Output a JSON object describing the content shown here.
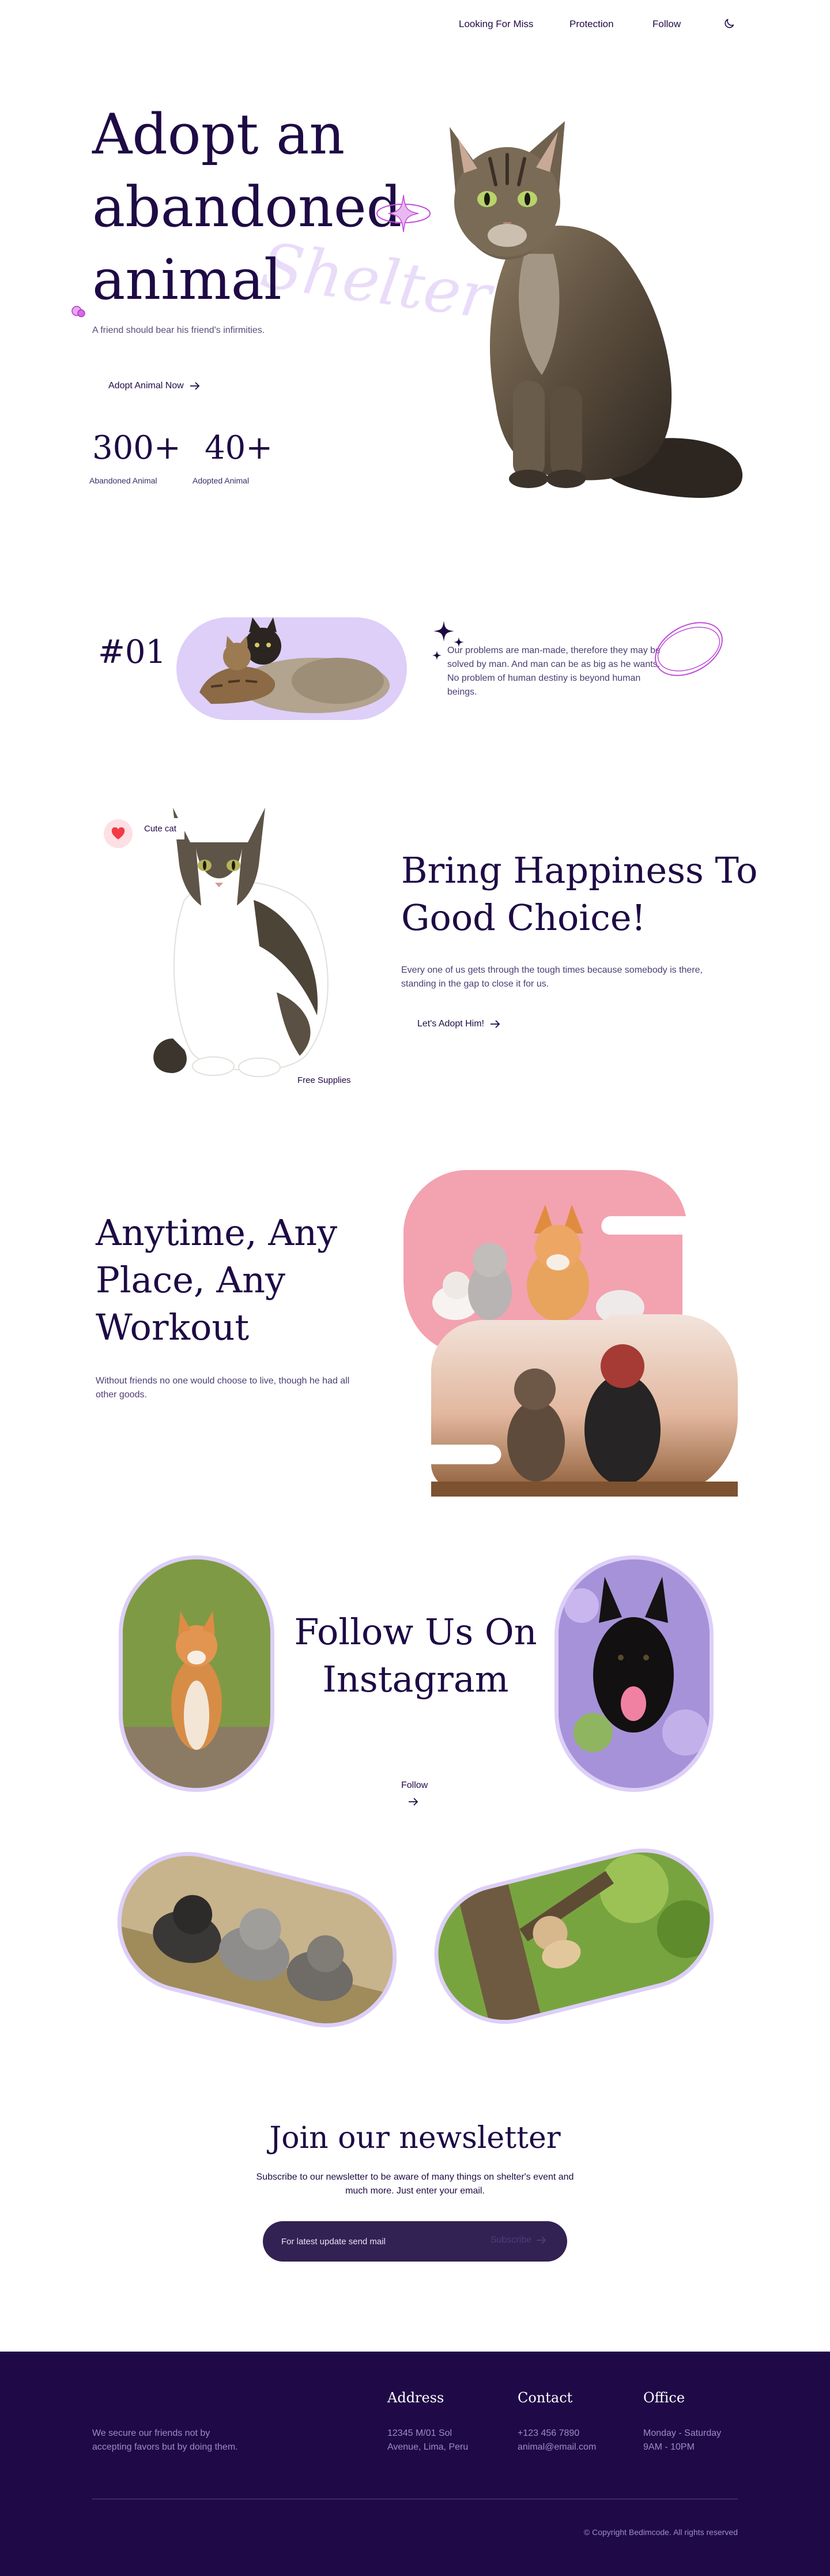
{
  "nav": {
    "links": [
      "Looking For Miss",
      "Protection",
      "Follow"
    ],
    "theme_icon": "moon-icon"
  },
  "hero": {
    "title_lines": [
      "Adopt an",
      "abandoned",
      "animal"
    ],
    "watermark": "Shelter",
    "subtitle": "A friend should bear his friend's infirmities.",
    "cta": "Adopt Animal Now",
    "stats": [
      {
        "value": "300+",
        "label": "Abandoned Animal"
      },
      {
        "value": "40+",
        "label": "Adopted Animal"
      }
    ]
  },
  "section_one": {
    "number": "#01",
    "text": "Our problems are man-made, therefore they may be solved by man. And man can be as big as he wants. No problem of human destiny is beyond human beings."
  },
  "happiness": {
    "badge": "Cute cat",
    "tag": "Free Supplies",
    "title": "Bring Happiness To Good Choice!",
    "text": "Every one of us gets through the tough times because somebody is there, standing in the gap to close it for us.",
    "cta": "Let's Adopt Him!"
  },
  "workout": {
    "title": "Anytime, Any Place, Any Workout",
    "text": "Without friends no one would choose to live, though he had all other goods."
  },
  "instagram": {
    "title": "Follow Us On Instagram",
    "follow_label": "Follow"
  },
  "newsletter": {
    "title": "Join our newsletter",
    "text": "Subscribe to our newsletter to be aware of many things on shelter's event and much more. Just enter your email.",
    "placeholder": "For latest update send mail",
    "button": "Subscribe"
  },
  "footer": {
    "about": "We secure our friends not by accepting favors but by doing them.",
    "columns": [
      {
        "title": "Address",
        "lines": [
          "12345 M/01 Sol",
          "Avenue, Lima, Peru"
        ]
      },
      {
        "title": "Contact",
        "lines": [
          "+123 456 7890",
          "animal@email.com"
        ]
      },
      {
        "title": "Office",
        "lines": [
          "Monday - Saturday",
          "9AM - 10PM"
        ]
      }
    ],
    "copyright": "© Copyright Bedimcode. All rights reserved"
  },
  "colors": {
    "primary": "#1e0a45",
    "accent_lavender": "#ddcff8",
    "accent_pink": "#c04bd8",
    "footer_bg": "#1f0a47",
    "newsletter_bg": "#322253"
  }
}
